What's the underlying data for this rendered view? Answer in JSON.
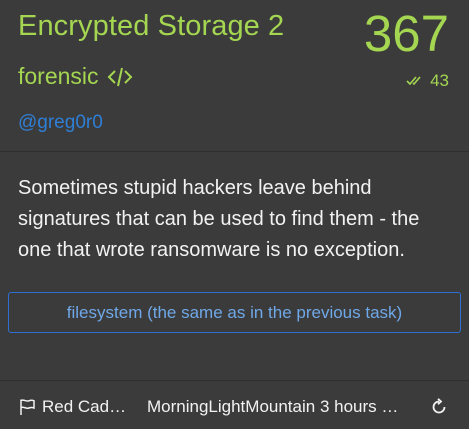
{
  "challenge": {
    "title": "Encrypted Storage 2",
    "score": "367",
    "category": "forensic",
    "category_icon": "code-icon",
    "solves": "43",
    "solves_icon": "double-check-icon",
    "author": "@greg0r0",
    "description": "Sometimes stupid hackers leave behind signatures that can be used to find them - the one that wrote ransomware is no exception.",
    "file_button": "filesystem (the same as in the previous task)"
  },
  "footer": {
    "flag_icon": "flag-icon",
    "team": "Red Cad…",
    "solver": "MorningLightMountain 3 hours …",
    "refresh_icon": "refresh-icon"
  },
  "colors": {
    "background": "#3b3b3b",
    "accent_green": "#a4d651",
    "link_blue": "#2f7fd6",
    "button_border": "#2f6fd0",
    "button_text": "#6fa8e8"
  }
}
